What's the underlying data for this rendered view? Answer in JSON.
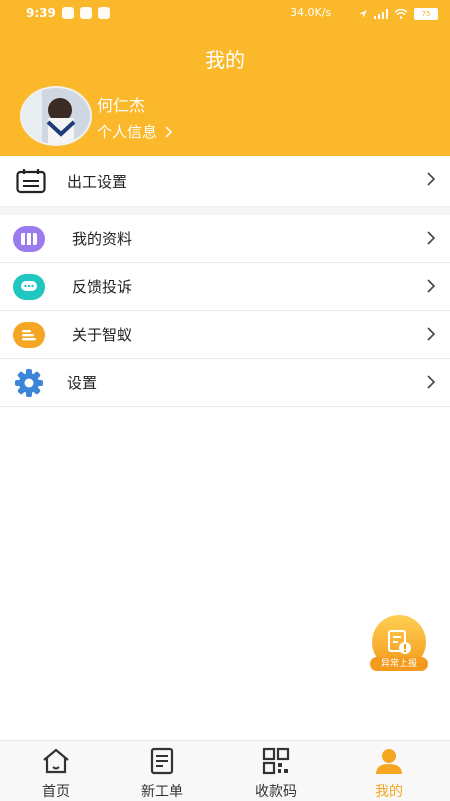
{
  "status_bar": {
    "time": "9:39",
    "net_speed": "34.0K/s",
    "battery": "75"
  },
  "header": {
    "title": "我的",
    "username": "何仁杰",
    "profile_link": "个人信息"
  },
  "menu": [
    {
      "label": "出工设置",
      "icon": "calendar-icon"
    },
    {
      "label": "我的资料",
      "icon": "folder-icon"
    },
    {
      "label": "反馈投诉",
      "icon": "chat-bubble-icon"
    },
    {
      "label": "关于智蚁",
      "icon": "info-stack-icon"
    },
    {
      "label": "设置",
      "icon": "gear-icon"
    }
  ],
  "fab": {
    "label": "异常上报",
    "icon": "report-icon"
  },
  "tabs": [
    {
      "label": "首页",
      "icon": "home-icon"
    },
    {
      "label": "新工单",
      "icon": "document-icon"
    },
    {
      "label": "收款码",
      "icon": "qr-code-icon"
    },
    {
      "label": "我的",
      "icon": "user-icon",
      "active": true
    }
  ],
  "colors": {
    "accent": "#fbb82b",
    "tab_active": "#f5a623",
    "gear": "#3b86d9"
  }
}
